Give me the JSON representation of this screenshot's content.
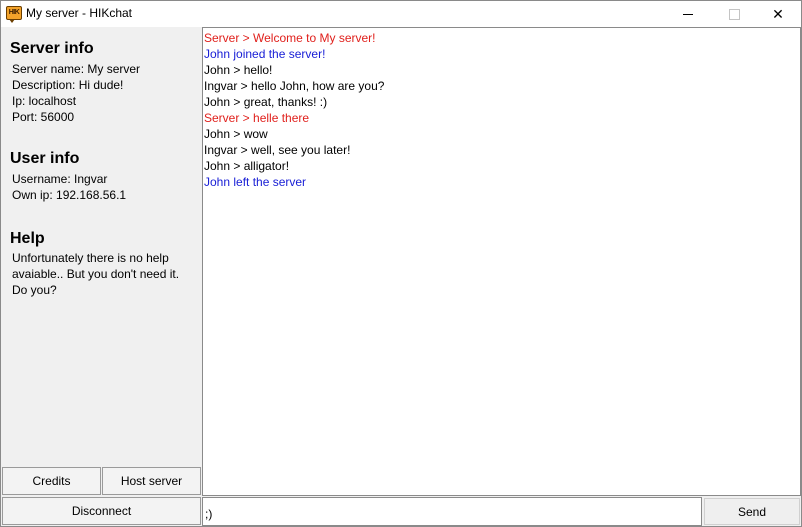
{
  "window": {
    "title": "My server - HIKchat",
    "icon_text": "HIK",
    "close_glyph": "✕"
  },
  "sidebar": {
    "server_info": {
      "title": "Server info",
      "lines": [
        "Server name: My server",
        "Description: Hi dude!",
        "Ip: localhost",
        "Port: 56000"
      ]
    },
    "user_info": {
      "title": "User info",
      "lines": [
        "Username: Ingvar",
        "Own ip: 192.168.56.1"
      ]
    },
    "help": {
      "title": "Help",
      "text": "Unfortunately there is no help avaiable.. But you don't need it. Do you?"
    },
    "buttons": {
      "credits": "Credits",
      "host_server": "Host server",
      "disconnect": "Disconnect"
    }
  },
  "colors": {
    "server_message": "#e0201c",
    "join_leave": "#1a20d6",
    "chat_text": "#000000"
  },
  "chat": {
    "messages": [
      {
        "text": "Server > Welcome to My server!",
        "kind": "server"
      },
      {
        "text": "John joined the server!",
        "kind": "event"
      },
      {
        "text": "John > hello!",
        "kind": "chat"
      },
      {
        "text": "Ingvar > hello John, how are you?",
        "kind": "chat"
      },
      {
        "text": "John > great, thanks! :)",
        "kind": "chat"
      },
      {
        "text": "Server > helle there",
        "kind": "server"
      },
      {
        "text": "John > wow",
        "kind": "chat"
      },
      {
        "text": "Ingvar > well, see you later!",
        "kind": "chat"
      },
      {
        "text": "John > alligator!",
        "kind": "chat"
      },
      {
        "text": "John left the server",
        "kind": "event"
      }
    ]
  },
  "composer": {
    "value": ";)",
    "send_label": "Send"
  }
}
